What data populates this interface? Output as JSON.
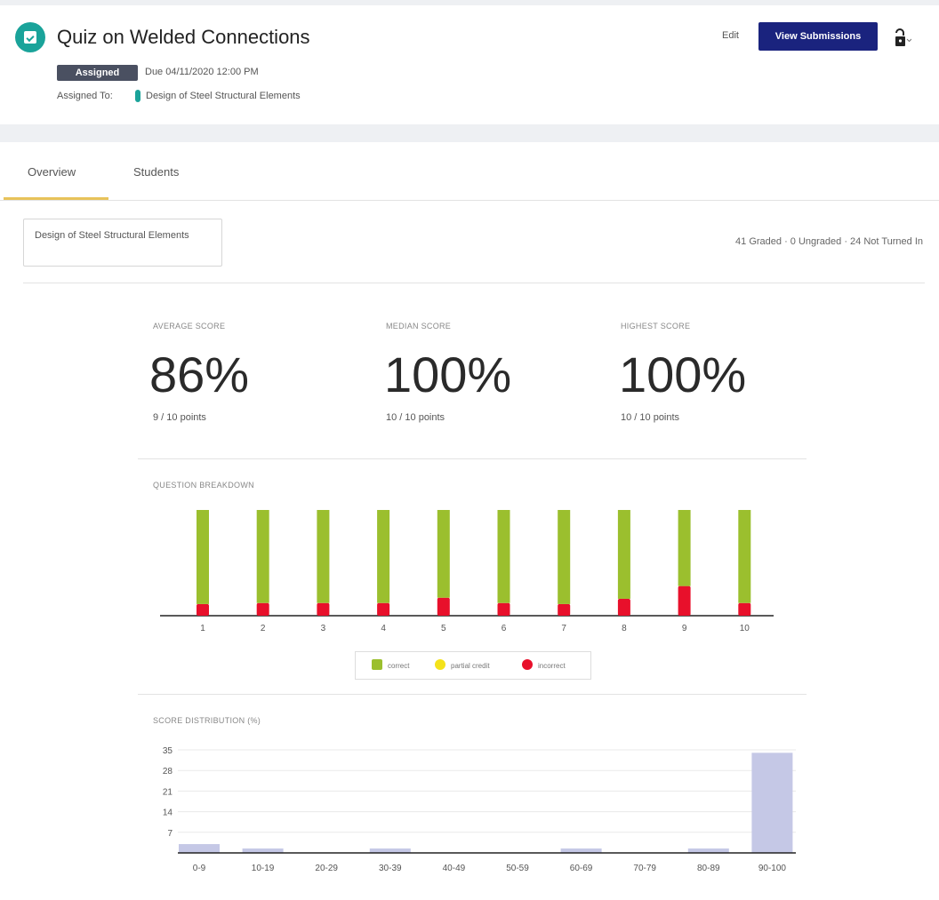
{
  "header": {
    "title": "Quiz on Welded Connections",
    "status": "Assigned",
    "due": "Due 04/11/2020 12:00 PM",
    "assigned_to_label": "Assigned To:",
    "course": "Design of Steel Structural Elements",
    "edit_label": "Edit",
    "view_submissions_label": "View Submissions",
    "icon": "quiz-icon",
    "lock_icon": "unlock-icon"
  },
  "tabs": [
    {
      "label": "Overview",
      "active": true
    },
    {
      "label": "Students",
      "active": false
    }
  ],
  "filter": {
    "section": "Design of Steel Structural Elements",
    "counts": "41 Graded · 0 Ungraded · 24 Not Turned In"
  },
  "stats": [
    {
      "label": "AVERAGE SCORE",
      "value": "86%",
      "points": "9 / 10 points"
    },
    {
      "label": "MEDIAN SCORE",
      "value": "100%",
      "points": "10 / 10 points"
    },
    {
      "label": "HIGHEST SCORE",
      "value": "100%",
      "points": "10 / 10 points"
    }
  ],
  "colors": {
    "correct": "#9bbf2e",
    "partial": "#f4e21a",
    "incorrect": "#e8102b",
    "distribution": "#c5c8e6",
    "accent": "#1a237e"
  },
  "chart_data": [
    {
      "type": "bar",
      "title": "QUESTION BREAKDOWN",
      "categories": [
        "1",
        "2",
        "3",
        "4",
        "5",
        "6",
        "7",
        "8",
        "9",
        "10"
      ],
      "series": [
        {
          "name": "correct",
          "values": [
            89,
            88,
            88,
            88,
            83,
            88,
            89,
            84,
            72,
            88
          ]
        },
        {
          "name": "partial credit",
          "values": [
            0,
            0,
            0,
            0,
            0,
            0,
            0,
            0,
            0,
            0
          ]
        },
        {
          "name": "incorrect",
          "values": [
            11,
            12,
            12,
            12,
            17,
            12,
            11,
            16,
            28,
            12
          ]
        }
      ],
      "stacked": true,
      "legend": "bottom"
    },
    {
      "type": "bar",
      "title": "SCORE DISTRIBUTION (%)",
      "categories": [
        "0-9",
        "10-19",
        "20-29",
        "30-39",
        "40-49",
        "50-59",
        "60-69",
        "70-79",
        "80-89",
        "90-100"
      ],
      "values": [
        3,
        1.5,
        0,
        1.5,
        0,
        0,
        1.5,
        0,
        1.5,
        34
      ],
      "yticks": [
        7,
        14,
        21,
        28,
        35
      ],
      "ylim": [
        0,
        35
      ],
      "grid": true
    }
  ]
}
